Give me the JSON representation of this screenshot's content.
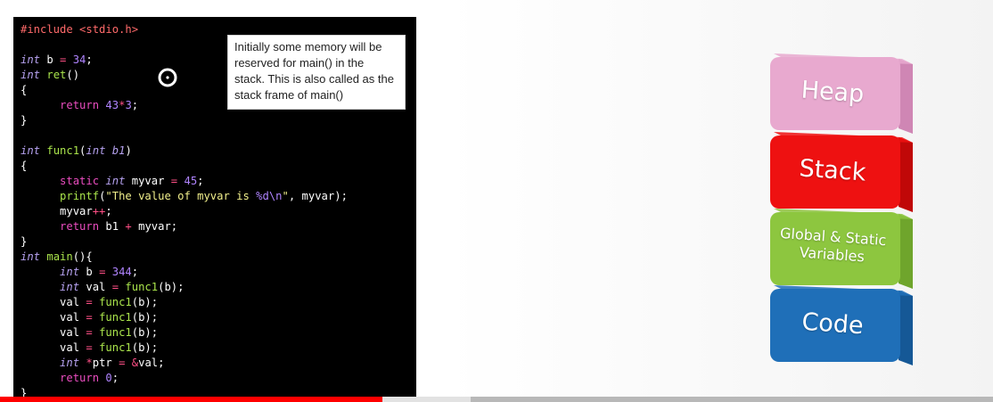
{
  "code_lines": [
    [
      {
        "t": "pp",
        "v": "#include <stdio.h>"
      }
    ],
    [],
    [
      {
        "t": "type",
        "v": "int"
      },
      {
        "t": "plain",
        "v": " b "
      },
      {
        "t": "op",
        "v": "="
      },
      {
        "t": "plain",
        "v": " "
      },
      {
        "t": "num",
        "v": "34"
      },
      {
        "t": "plain",
        "v": ";"
      }
    ],
    [
      {
        "t": "type",
        "v": "int"
      },
      {
        "t": "plain",
        "v": " "
      },
      {
        "t": "fn",
        "v": "ret"
      },
      {
        "t": "plain",
        "v": "()"
      }
    ],
    [
      {
        "t": "plain",
        "v": "{"
      }
    ],
    [
      {
        "t": "plain",
        "v": "      "
      },
      {
        "t": "kw",
        "v": "return"
      },
      {
        "t": "plain",
        "v": " "
      },
      {
        "t": "num",
        "v": "43"
      },
      {
        "t": "op",
        "v": "*"
      },
      {
        "t": "num",
        "v": "3"
      },
      {
        "t": "plain",
        "v": ";"
      }
    ],
    [
      {
        "t": "plain",
        "v": "}"
      }
    ],
    [],
    [
      {
        "t": "type",
        "v": "int"
      },
      {
        "t": "plain",
        "v": " "
      },
      {
        "t": "fn",
        "v": "func1"
      },
      {
        "t": "plain",
        "v": "("
      },
      {
        "t": "type",
        "v": "int"
      },
      {
        "t": "plain",
        "v": " "
      },
      {
        "t": "type",
        "v": "b1"
      },
      {
        "t": "plain",
        "v": ")"
      }
    ],
    [
      {
        "t": "plain",
        "v": "{"
      }
    ],
    [
      {
        "t": "plain",
        "v": "      "
      },
      {
        "t": "kw",
        "v": "static"
      },
      {
        "t": "plain",
        "v": " "
      },
      {
        "t": "type",
        "v": "int"
      },
      {
        "t": "plain",
        "v": " myvar "
      },
      {
        "t": "op",
        "v": "="
      },
      {
        "t": "plain",
        "v": " "
      },
      {
        "t": "num",
        "v": "45"
      },
      {
        "t": "plain",
        "v": ";"
      }
    ],
    [
      {
        "t": "plain",
        "v": "      "
      },
      {
        "t": "fn",
        "v": "printf"
      },
      {
        "t": "plain",
        "v": "("
      },
      {
        "t": "str",
        "v": "\"The value of myvar is "
      },
      {
        "t": "esc",
        "v": "%d\\n"
      },
      {
        "t": "str",
        "v": "\""
      },
      {
        "t": "plain",
        "v": ", myvar);"
      }
    ],
    [
      {
        "t": "plain",
        "v": "      myvar"
      },
      {
        "t": "op",
        "v": "++"
      },
      {
        "t": "plain",
        "v": ";"
      }
    ],
    [
      {
        "t": "plain",
        "v": "      "
      },
      {
        "t": "kw",
        "v": "return"
      },
      {
        "t": "plain",
        "v": " b1 "
      },
      {
        "t": "op",
        "v": "+"
      },
      {
        "t": "plain",
        "v": " myvar;"
      }
    ],
    [
      {
        "t": "plain",
        "v": "}"
      }
    ],
    [
      {
        "t": "type",
        "v": "int"
      },
      {
        "t": "plain",
        "v": " "
      },
      {
        "t": "fn",
        "v": "main"
      },
      {
        "t": "plain",
        "v": "(){"
      }
    ],
    [
      {
        "t": "plain",
        "v": "      "
      },
      {
        "t": "type",
        "v": "int"
      },
      {
        "t": "plain",
        "v": " b "
      },
      {
        "t": "op",
        "v": "="
      },
      {
        "t": "plain",
        "v": " "
      },
      {
        "t": "num",
        "v": "344"
      },
      {
        "t": "plain",
        "v": ";"
      }
    ],
    [
      {
        "t": "plain",
        "v": "      "
      },
      {
        "t": "type",
        "v": "int"
      },
      {
        "t": "plain",
        "v": " val "
      },
      {
        "t": "op",
        "v": "="
      },
      {
        "t": "plain",
        "v": " "
      },
      {
        "t": "fn",
        "v": "func1"
      },
      {
        "t": "plain",
        "v": "(b);"
      }
    ],
    [
      {
        "t": "plain",
        "v": "      val "
      },
      {
        "t": "op",
        "v": "="
      },
      {
        "t": "plain",
        "v": " "
      },
      {
        "t": "fn",
        "v": "func1"
      },
      {
        "t": "plain",
        "v": "(b);"
      }
    ],
    [
      {
        "t": "plain",
        "v": "      val "
      },
      {
        "t": "op",
        "v": "="
      },
      {
        "t": "plain",
        "v": " "
      },
      {
        "t": "fn",
        "v": "func1"
      },
      {
        "t": "plain",
        "v": "(b);"
      }
    ],
    [
      {
        "t": "plain",
        "v": "      val "
      },
      {
        "t": "op",
        "v": "="
      },
      {
        "t": "plain",
        "v": " "
      },
      {
        "t": "fn",
        "v": "func1"
      },
      {
        "t": "plain",
        "v": "(b);"
      }
    ],
    [
      {
        "t": "plain",
        "v": "      val "
      },
      {
        "t": "op",
        "v": "="
      },
      {
        "t": "plain",
        "v": " "
      },
      {
        "t": "fn",
        "v": "func1"
      },
      {
        "t": "plain",
        "v": "(b);"
      }
    ],
    [
      {
        "t": "plain",
        "v": "      "
      },
      {
        "t": "type",
        "v": "int"
      },
      {
        "t": "plain",
        "v": " "
      },
      {
        "t": "op",
        "v": "*"
      },
      {
        "t": "plain",
        "v": "ptr "
      },
      {
        "t": "op",
        "v": "="
      },
      {
        "t": "plain",
        "v": " "
      },
      {
        "t": "op",
        "v": "&"
      },
      {
        "t": "plain",
        "v": "val;"
      }
    ],
    [
      {
        "t": "plain",
        "v": "      "
      },
      {
        "t": "kw",
        "v": "return"
      },
      {
        "t": "plain",
        "v": " "
      },
      {
        "t": "num",
        "v": "0"
      },
      {
        "t": "plain",
        "v": ";"
      }
    ],
    [
      {
        "t": "plain",
        "v": "}"
      }
    ]
  ],
  "note": {
    "lines": [
      "Initially some memory will be",
      "reserved for main() in the",
      "stack. This is also called as the",
      "stack frame of main()"
    ]
  },
  "memory_blocks": [
    {
      "name": "heap",
      "label": "Heap",
      "color": "#e8a9cf",
      "dark": "#cf86b4"
    },
    {
      "name": "stack",
      "label": "Stack",
      "color": "#ee1111",
      "dark": "#c00808"
    },
    {
      "name": "global-static",
      "label": "Global & Static\nVariables",
      "color": "#8dc63f",
      "dark": "#6fa52c"
    },
    {
      "name": "code",
      "label": "Code",
      "color": "#1f6fb8",
      "dark": "#155896"
    }
  ],
  "video": {
    "progress_fraction": 0.385,
    "buffered_fraction": 0.474,
    "progress_color": "#ff0000"
  },
  "icons": {
    "cursor": "circle-cursor-icon"
  }
}
